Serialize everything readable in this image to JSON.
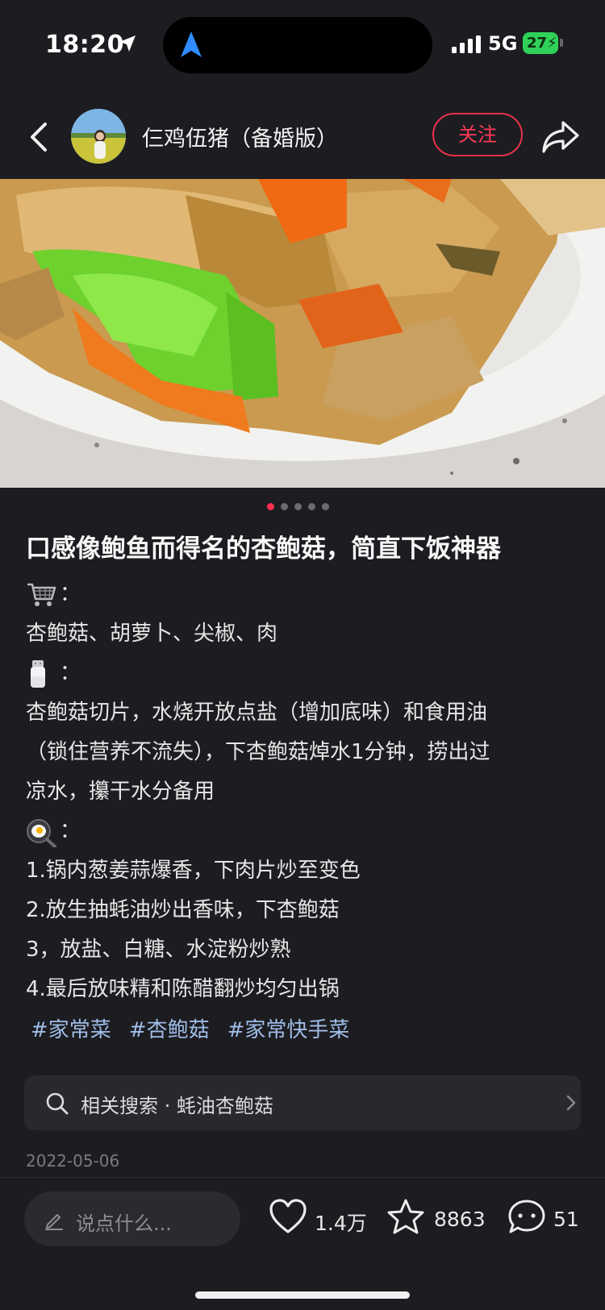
{
  "status_bar": {
    "time": "18:20",
    "network": "5G",
    "battery": "27"
  },
  "header": {
    "author_name": "仨鸡伍猪（备婚版）",
    "follow_label": "关注"
  },
  "carousel": {
    "total": 5,
    "current": 1
  },
  "post": {
    "title": "口感像鲍鱼而得名的杏鲍菇，简直下饭神器",
    "emoji_colon": "：",
    "ingredients": "杏鲍菇、胡萝卜、尖椒、肉",
    "prep_lines": [
      "杏鲍菇切片，水烧开放点盐（增加底味）和食用油",
      "（锁住营养不流失），下杏鲍菇焯水1分钟，捞出过",
      "凉水，攥干水分备用"
    ],
    "steps": [
      "1.锅内葱姜蒜爆香，下肉片炒至变色",
      "2.放生抽蚝油炒出香味，下杏鲍菇",
      "3，放盐、白糖、水淀粉炒熟",
      "4.最后放味精和陈醋翻炒均匀出锅"
    ],
    "tags": [
      "#家常菜",
      "#杏鲍菇",
      "#家常快手菜"
    ]
  },
  "related_search": {
    "text": "相关搜索 · 蚝油杏鲍菇"
  },
  "date": "2022-05-06",
  "bottom_bar": {
    "comment_placeholder": "说点什么...",
    "likes": "1.4万",
    "favorites": "8863",
    "comments": "51"
  },
  "colors": {
    "accent": "#ff3a57",
    "tag": "#9fbde6",
    "background": "#1c1c21"
  },
  "icons": {
    "cart": "shopping-cart-icon",
    "salt": "salt-shaker-icon",
    "pan": "frying-pan-egg-icon"
  }
}
